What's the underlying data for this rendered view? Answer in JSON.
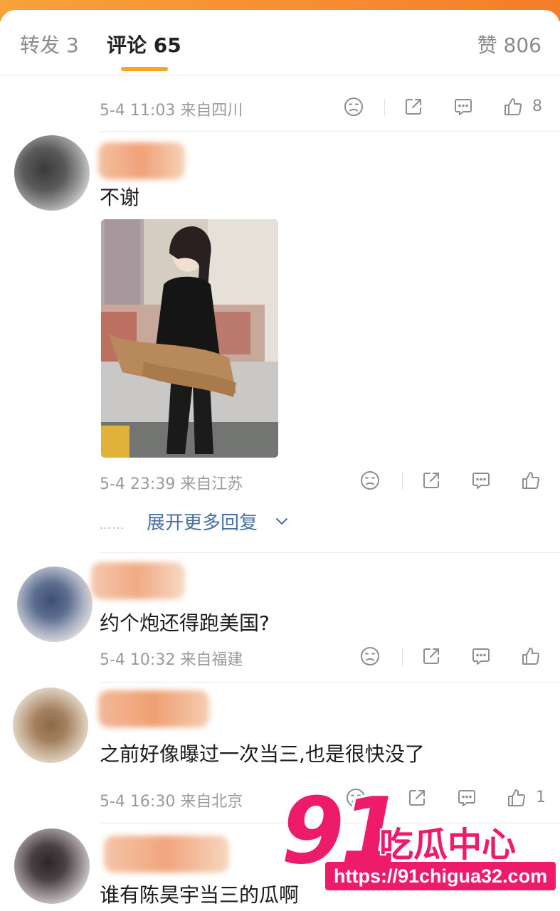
{
  "tabs": {
    "repost": "转发 3",
    "comment": "评论 65",
    "like": "赞 806"
  },
  "comments": [
    {
      "time": "5-4 11:03",
      "location": "来自四川",
      "likes": "8"
    },
    {
      "text": "不谢",
      "time": "5-4 23:39",
      "location": "来自江苏",
      "likes": ""
    },
    {
      "text": "约个炮还得跑美国?",
      "time": "5-4 10:32",
      "location": "来自福建",
      "likes": ""
    },
    {
      "text": "之前好像曝过一次当三,也是很快没了",
      "time": "5-4 16:30",
      "location": "来自北京",
      "likes": "1"
    },
    {
      "text": "谁有陈昊宇当三的瓜啊"
    }
  ],
  "expand": {
    "dots": "……",
    "label": "展开更多回复"
  },
  "watermark": {
    "number": "91",
    "name": "吃瓜中心",
    "url": "https://91chigua32.com"
  },
  "colors": {
    "accent": "#f5a623",
    "link": "#4a6fa5",
    "watermark": "#ee1b6b"
  },
  "icons": [
    "dislike-icon",
    "share-icon",
    "comment-icon",
    "thumbs-up-icon",
    "chevron-down-icon"
  ]
}
